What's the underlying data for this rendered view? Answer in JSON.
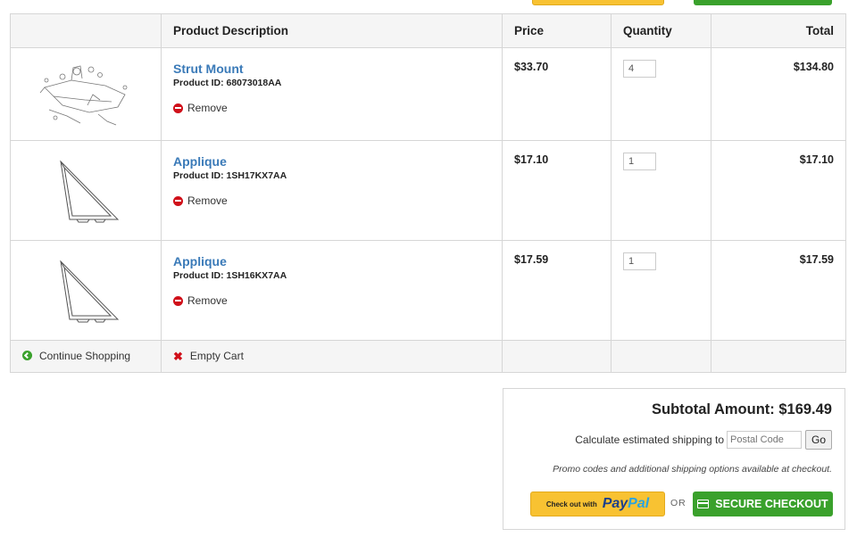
{
  "table": {
    "headers": {
      "image": "",
      "description": "Product Description",
      "price": "Price",
      "quantity": "Quantity",
      "total": "Total"
    },
    "items": [
      {
        "name": "Strut Mount",
        "product_id": "Product ID: 68073018AA",
        "remove": "Remove",
        "price": "$33.70",
        "qty": "4",
        "total": "$134.80",
        "image": "strut-mount-diagram"
      },
      {
        "name": "Applique",
        "product_id": "Product ID: 1SH17KX7AA",
        "remove": "Remove",
        "price": "$17.10",
        "qty": "1",
        "total": "$17.10",
        "image": "applique-diagram"
      },
      {
        "name": "Applique",
        "product_id": "Product ID: 1SH16KX7AA",
        "remove": "Remove",
        "price": "$17.59",
        "qty": "1",
        "total": "$17.59",
        "image": "applique-diagram"
      }
    ],
    "footer": {
      "continue": "Continue Shopping",
      "empty": "Empty Cart"
    }
  },
  "summary": {
    "subtotal": "Subtotal Amount: $169.49",
    "shipping_label": "Calculate estimated shipping to",
    "postal_placeholder": "Postal Code",
    "go": "Go",
    "promo": "Promo codes and additional shipping options available at checkout.",
    "paypal_small": "Check out with",
    "paypal_a": "Pay",
    "paypal_b": "Pal",
    "or": "OR",
    "secure": "SECURE CHECKOUT"
  },
  "colors": {
    "link": "#3a7ab8",
    "green": "#3aa12c",
    "paypal_yellow": "#f8c232",
    "remove_red": "#d0101a"
  }
}
